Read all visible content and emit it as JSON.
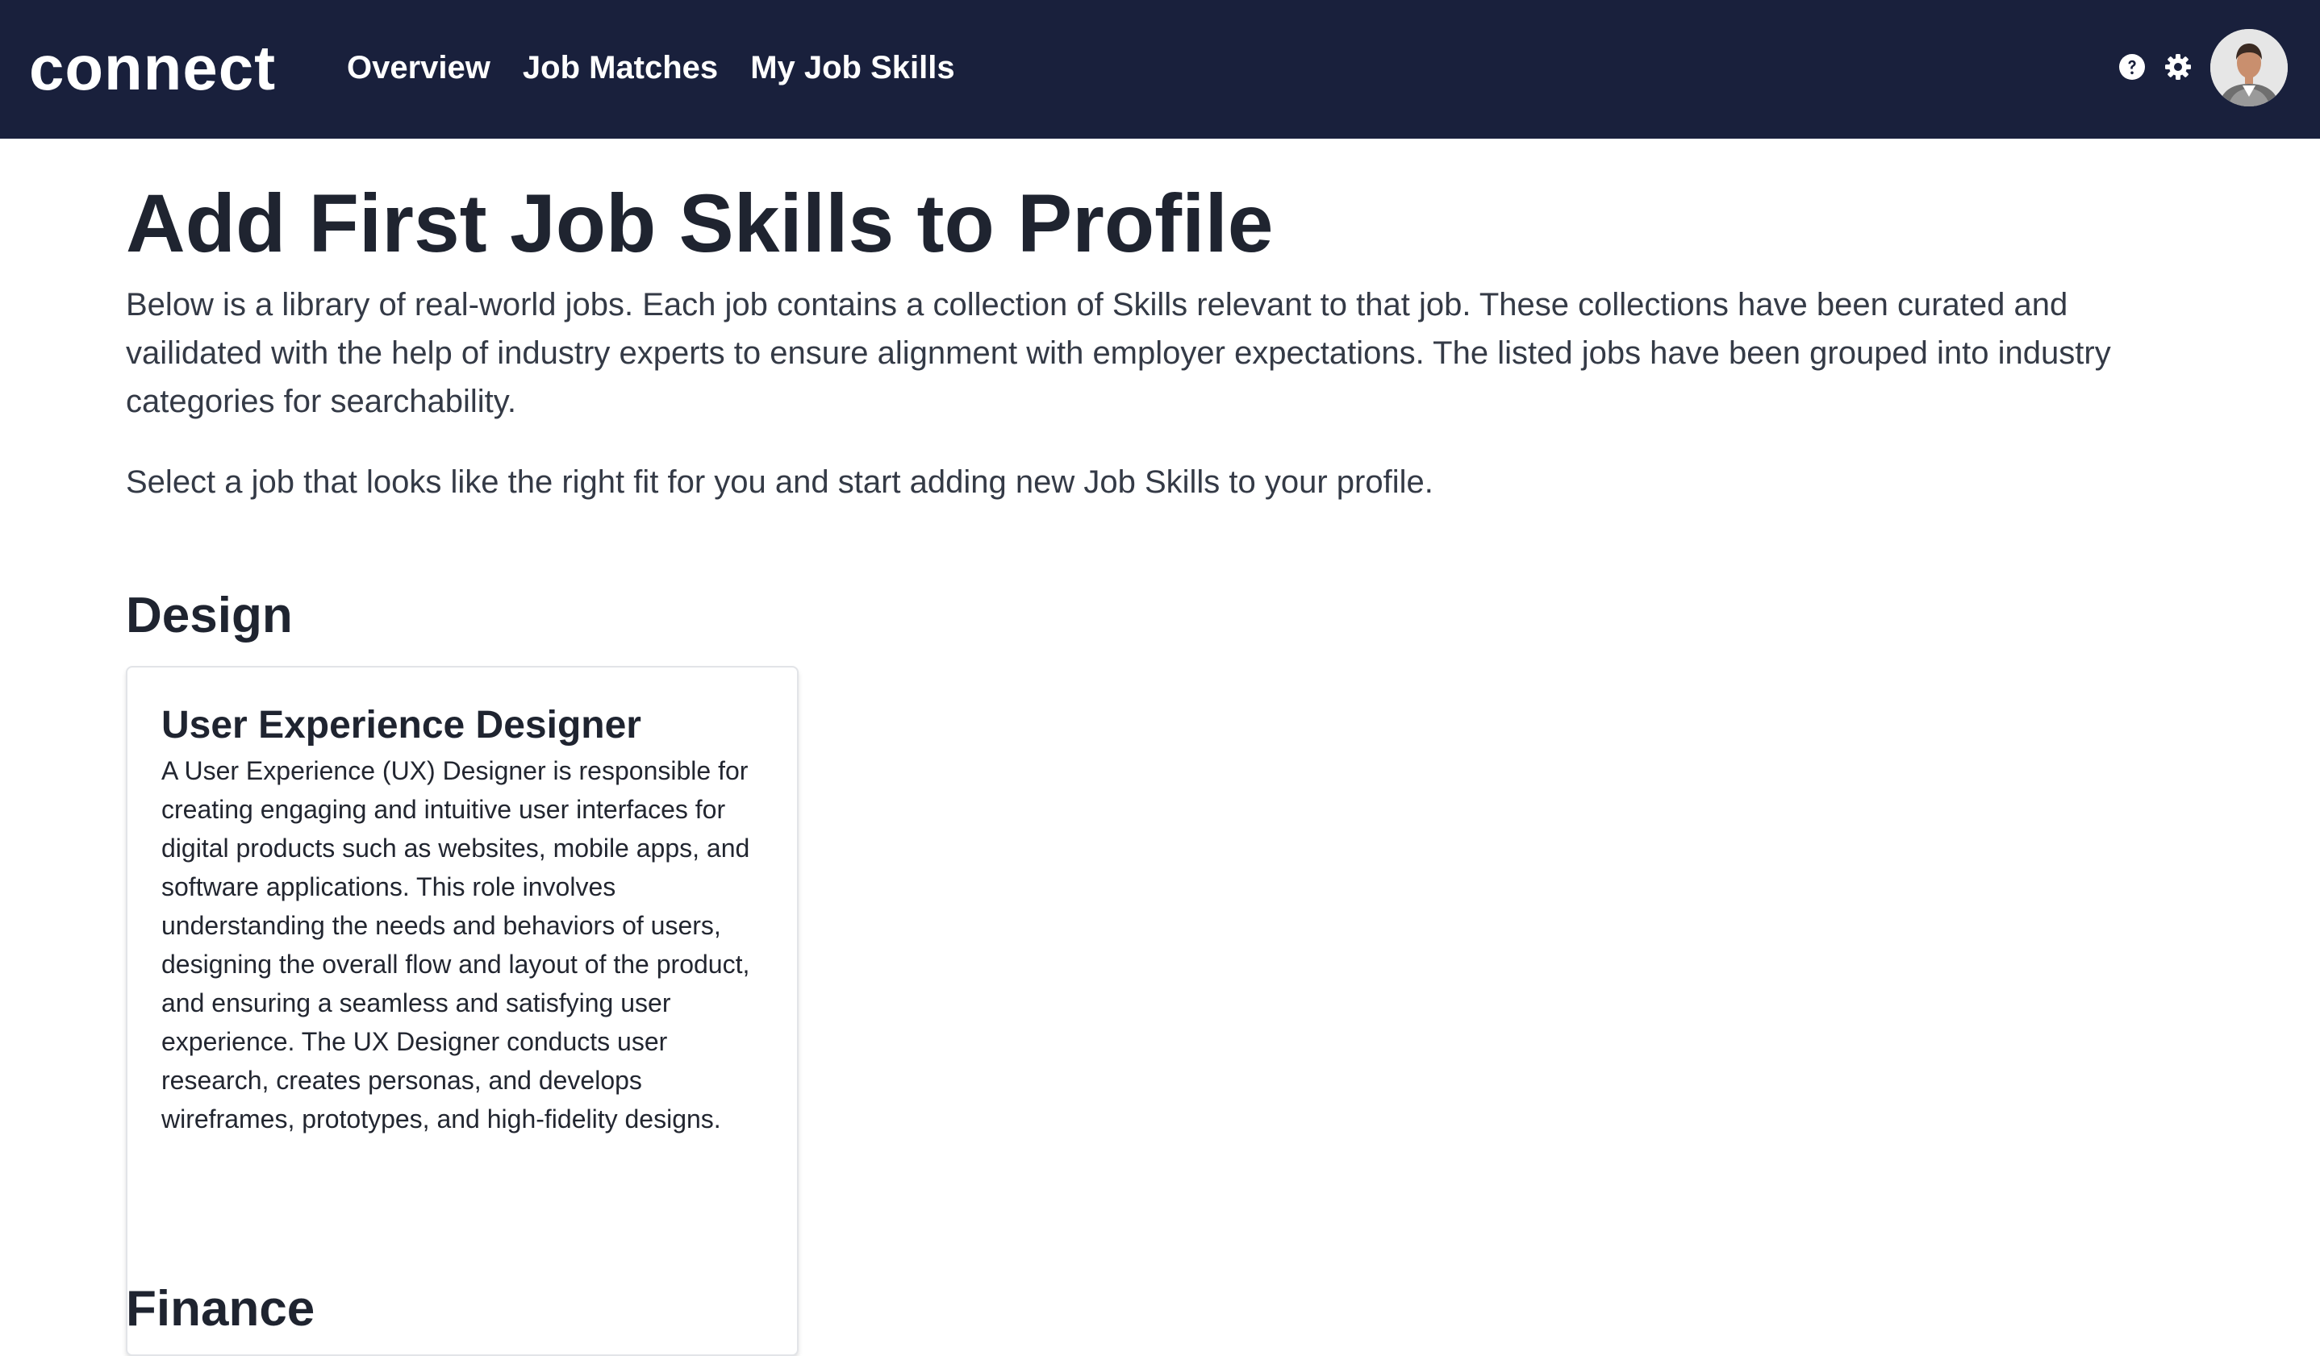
{
  "header": {
    "logo": "connect",
    "nav": [
      "Overview",
      "Job Matches",
      "My Job Skills"
    ],
    "icons": [
      "help-icon",
      "gear-icon",
      "avatar"
    ],
    "bg_color": "#19203c"
  },
  "main": {
    "title": "Add First Job Skills to Profile",
    "intro": "Below is a library of real-world jobs. Each job contains a collection of Skills relevant to that job. These collections have been curated and vailidated with the help of industry experts to ensure alignment with employer expectations. The listed jobs have been grouped into industry categories for searchability.",
    "intro2": "Select a job that looks like the right fit for you and start adding new Job Skills to your profile.",
    "sections": [
      {
        "title": "Design",
        "jobs": [
          {
            "title": "User Experience Designer",
            "description": "A User Experience (UX) Designer is responsible for creating engaging and intuitive user interfaces for digital products such as websites, mobile apps, and software applications. This role involves understanding the needs and behaviors of users, designing the overall flow and layout of the product, and ensuring a seamless and satisfying user experience. The UX Designer conducts user research, creates personas, and develops wireframes, prototypes, and high-fidelity designs."
          }
        ]
      },
      {
        "title": "Finance"
      }
    ]
  }
}
